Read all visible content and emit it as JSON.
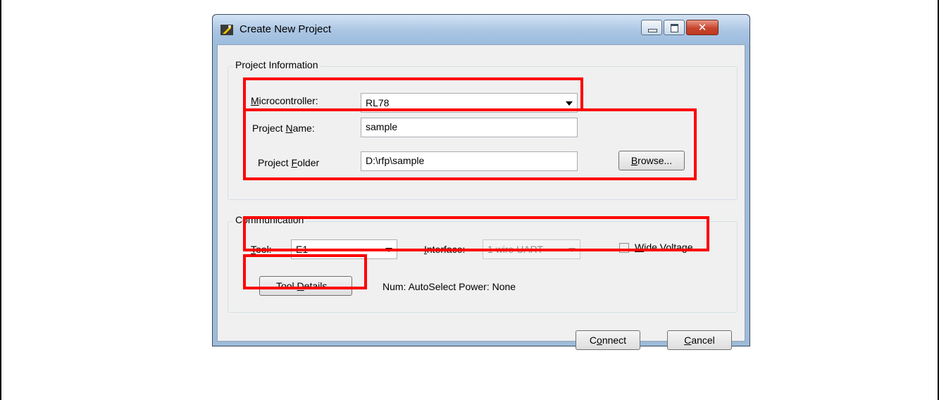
{
  "window": {
    "title": "Create New Project",
    "close_glyph": "✕"
  },
  "project_info": {
    "group_title": "Project Information",
    "microcontroller": {
      "label_pre": "",
      "label_u": "M",
      "label_post": "icrocontroller:",
      "value": "RL78"
    },
    "project_name": {
      "label_pre": "Project ",
      "label_u": "N",
      "label_post": "ame:",
      "value": "sample"
    },
    "project_folder": {
      "label_pre": "Project ",
      "label_u": "F",
      "label_post": "older",
      "value": "D:\\rfp\\sample"
    },
    "browse": {
      "label_u": "B",
      "label_post": "rowse..."
    }
  },
  "communication": {
    "group_title": "Communication",
    "tool": {
      "label_u": "T",
      "label_post": "ool:",
      "value": "E1"
    },
    "interface": {
      "label_u": "I",
      "label_post": "nterface:",
      "value": "1 wire UART"
    },
    "wide_voltage": {
      "label_u": "W",
      "label_post": "ide Voltage",
      "checked": false
    },
    "tool_details": {
      "label_pre": "Tool ",
      "label_u": "D",
      "label_post": "etails..."
    },
    "status": "Num: AutoSelect  Power: None"
  },
  "footer": {
    "connect": {
      "label_pre": "C",
      "label_u": "o",
      "label_post": "nnect"
    },
    "cancel": {
      "label_u": "C",
      "label_post": "ancel"
    }
  },
  "colors": {
    "highlight": "#ff0000",
    "titlebar": "#aac5e3"
  }
}
